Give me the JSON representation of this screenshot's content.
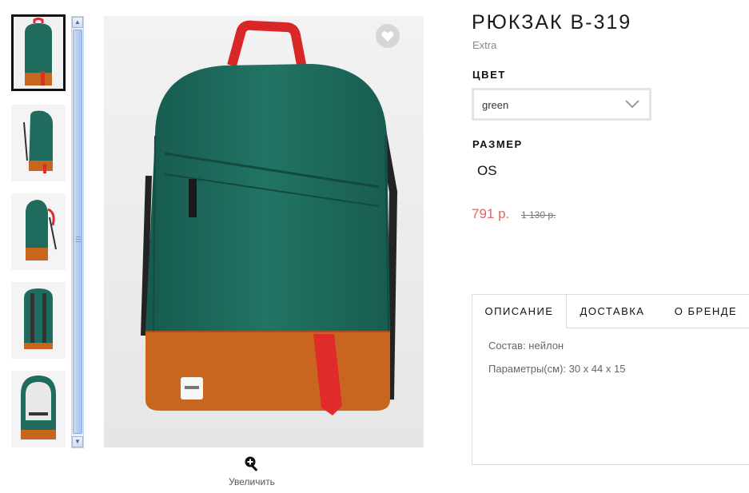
{
  "product": {
    "title": "РЮКЗАК B-319",
    "brand": "Extra",
    "color_label": "ЦВЕТ",
    "color_value": "green",
    "size_label": "РАЗМЕР",
    "size_value": "OS",
    "price": "791 р.",
    "old_price": "1 130 р."
  },
  "gallery": {
    "zoom_label": "Увеличить",
    "thumbnail_count": 5,
    "selected_index": 0,
    "bag_colors": {
      "body": "#1f6b5e",
      "bottom": "#c8651f",
      "strap": "#e12b2b"
    },
    "fav_icon": "heart-icon"
  },
  "tabs": {
    "items": [
      {
        "label": "ОПИСАНИЕ"
      },
      {
        "label": "ДОСТАВКА"
      },
      {
        "label": "О БРЕНДЕ"
      }
    ],
    "content": {
      "composition": "Состав: нейлон",
      "params": "Параметры(см): 30 x 44 x 15"
    }
  },
  "colors": {
    "price": "#e06666"
  }
}
